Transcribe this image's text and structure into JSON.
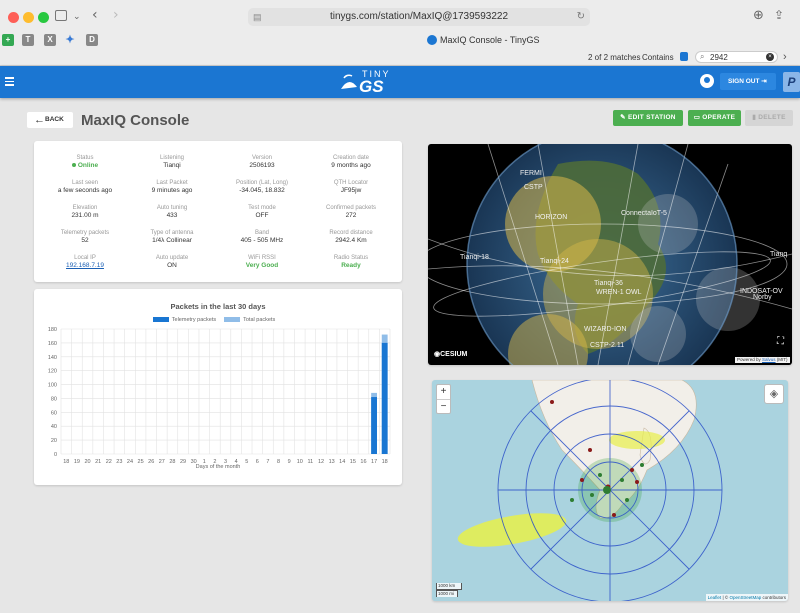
{
  "browser": {
    "url": "tinygs.com/station/MaxIQ@1739593222",
    "tab_title": "MaxIQ Console - TinyGS",
    "find_status": "2 of 2 matches",
    "find_mode": "Contains",
    "find_query": "2942"
  },
  "header": {
    "logo_top": "TINY",
    "logo_bottom": "GS",
    "signout_label": "SIGN OUT"
  },
  "station": {
    "back_label": "BACK",
    "title": "MaxIQ Console",
    "edit_label": "EDIT STATION",
    "operate_label": "OPERATE",
    "delete_label": "DELETE"
  },
  "info": [
    {
      "label": "Status",
      "value": "Online",
      "color": "#4caf50"
    },
    {
      "label": "Listening",
      "value": "Tianqi"
    },
    {
      "label": "Version",
      "value": "2506193"
    },
    {
      "label": "Creation date",
      "value": "9 months ago"
    },
    {
      "label": "Last seen",
      "value": "a few seconds ago"
    },
    {
      "label": "Last Packet",
      "value": "9 minutes ago"
    },
    {
      "label": "Position (Lat, Long)",
      "value": "-34.045, 18.832"
    },
    {
      "label": "QTH Locator",
      "value": "JF95jw"
    },
    {
      "label": "Elevation",
      "value": "231.00 m"
    },
    {
      "label": "Auto tuning",
      "value": "433"
    },
    {
      "label": "Test mode",
      "value": "OFF"
    },
    {
      "label": "Confirmed packets",
      "value": "272"
    },
    {
      "label": "Telemetry packets",
      "value": "52"
    },
    {
      "label": "Type of antenna",
      "value": "1/4λ Collinear"
    },
    {
      "label": "Band",
      "value": "405 - 505 MHz"
    },
    {
      "label": "Record distance",
      "value": "2942.4 Km"
    },
    {
      "label": "Local IP",
      "value": "192.168.7.19",
      "link": true
    },
    {
      "label": "Auto update",
      "value": "ON"
    },
    {
      "label": "WiFi RSSI",
      "value": "Very Good",
      "color": "#4caf50"
    },
    {
      "label": "Radio Status",
      "value": "Ready",
      "color": "#4caf50"
    }
  ],
  "chart_data": {
    "type": "bar",
    "title": "Packets in the last 30 days",
    "xlabel": "Days of the month",
    "ylabel": "",
    "ylim": [
      0,
      180
    ],
    "yticks": [
      0,
      20,
      40,
      60,
      80,
      100,
      120,
      140,
      160,
      180
    ],
    "categories": [
      "18",
      "19",
      "20",
      "21",
      "22",
      "23",
      "24",
      "25",
      "26",
      "27",
      "28",
      "29",
      "30",
      "1",
      "2",
      "3",
      "4",
      "5",
      "6",
      "7",
      "8",
      "9",
      "10",
      "11",
      "12",
      "13",
      "14",
      "15",
      "16",
      "17",
      "18"
    ],
    "series": [
      {
        "name": "Telemetry packets",
        "color": "#1976d2",
        "values": [
          0,
          0,
          0,
          0,
          0,
          0,
          0,
          0,
          0,
          0,
          0,
          0,
          0,
          0,
          0,
          0,
          0,
          0,
          0,
          0,
          0,
          0,
          0,
          0,
          0,
          0,
          0,
          0,
          0,
          82,
          160
        ]
      },
      {
        "name": "Total packets",
        "color": "#90bde8",
        "values": [
          0,
          0,
          0,
          0,
          0,
          0,
          0,
          0,
          0,
          0,
          0,
          0,
          0,
          0,
          0,
          0,
          0,
          0,
          0,
          0,
          0,
          0,
          0,
          0,
          0,
          0,
          0,
          0,
          0,
          88,
          172
        ]
      }
    ]
  },
  "globe": {
    "brand": "CESIUM",
    "credit_prefix": "Powered by",
    "credit_link": "Salvus",
    "credit_suffix": "(MIT)",
    "labels": [
      "FERMI",
      "CSTP",
      "HORIZON",
      "ConnectaIoT-5",
      "Tianqi-18",
      "Tianqi-24",
      "Tianqi-36",
      "WREN-1 OWL",
      "Tianq",
      "INDOSAT-OV",
      "Norby",
      "WIZARD-ION",
      "CSTP-2.11"
    ]
  },
  "map": {
    "zoom_in": "+",
    "zoom_out": "−",
    "scale_km": "1000 km",
    "scale_mi": "1000 mi",
    "attr_leaflet": "Leaflet",
    "attr_osm": "OpenStreetMap",
    "attr_suffix": "contributors"
  }
}
